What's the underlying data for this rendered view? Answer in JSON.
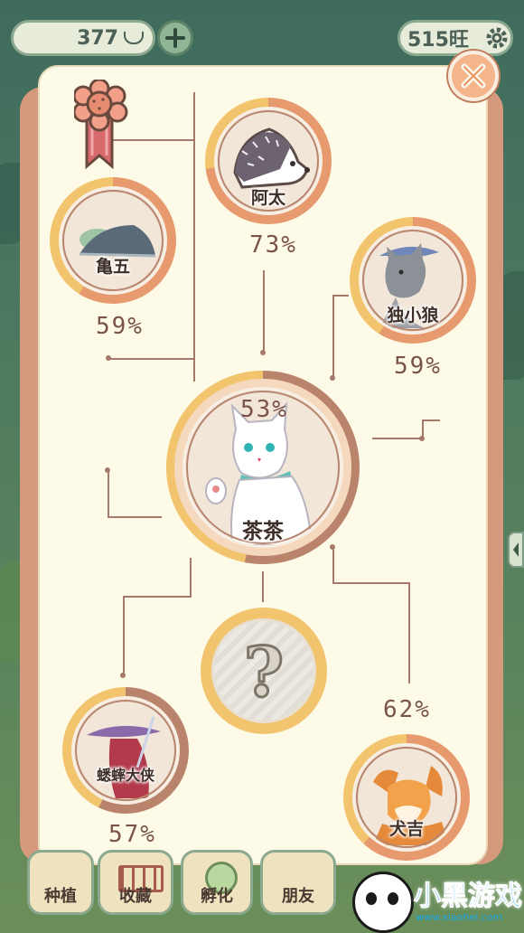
{
  "currency": {
    "coins": "377",
    "wang": "515旺"
  },
  "characters": {
    "atai": {
      "name": "阿太",
      "percent": "73%"
    },
    "guiwu": {
      "name": "亀五",
      "percent": "59%"
    },
    "duxiaolang": {
      "name": "独小狼",
      "percent": "59%"
    },
    "chacha": {
      "name": "茶茶",
      "percent": "53%"
    },
    "unknown": {
      "symbol": "?"
    },
    "xishuai": {
      "name": "蟋蟀大侠",
      "percent": "57%"
    },
    "quanji": {
      "name": "犬吉",
      "percent": "62%"
    }
  },
  "nav": {
    "plant": "种植",
    "collection": "收藏",
    "hatch": "孵化",
    "friends": "朋友"
  },
  "watermark": {
    "text": "小黑游戏",
    "url": "www.xiaohei.com"
  },
  "colors": {
    "ring_orange": "#e79a6e",
    "ring_yellow": "#f2c46d",
    "ring_brown": "#b9836c",
    "panel": "#fdfbe7"
  }
}
